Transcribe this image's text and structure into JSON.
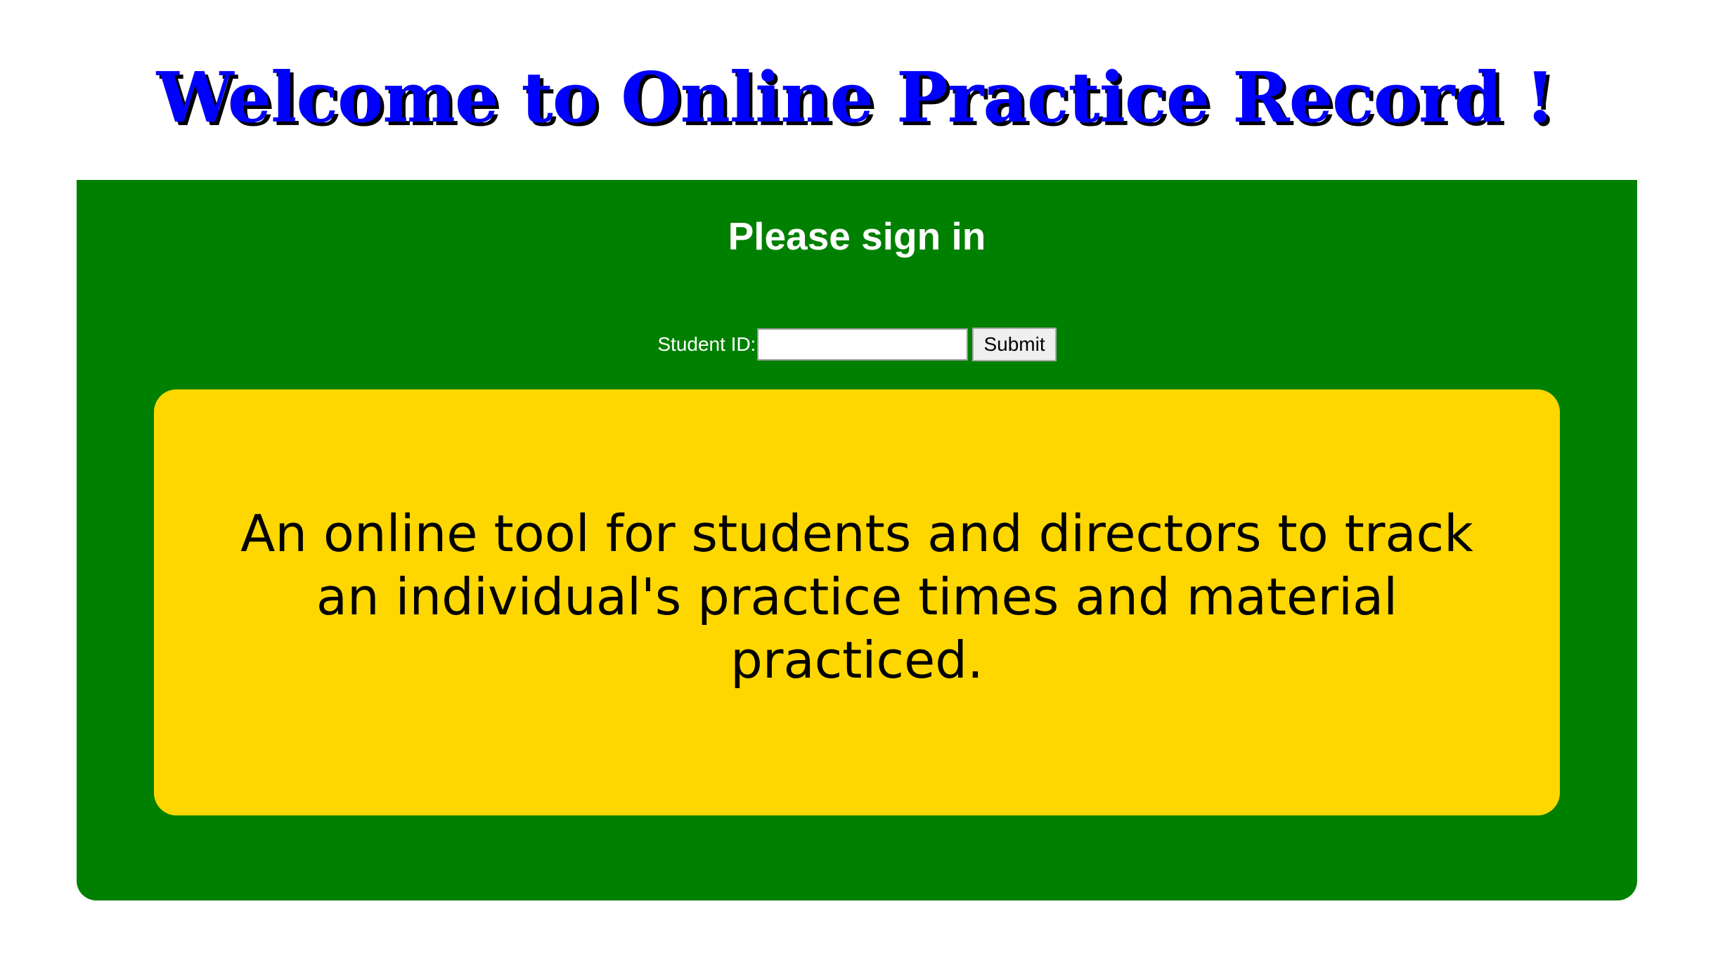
{
  "header": {
    "title": "Welcome to Online Practice Record !"
  },
  "signin": {
    "heading": "Please sign in",
    "student_id_label": "Student ID:",
    "student_id_value": "",
    "student_id_placeholder": "",
    "submit_label": "Submit"
  },
  "description": {
    "text": "An online tool for students and directors to track an individual's practice times and material practiced."
  },
  "colors": {
    "title": "#0000ff",
    "panel_background": "#008000",
    "card_background": "#ffd700"
  }
}
